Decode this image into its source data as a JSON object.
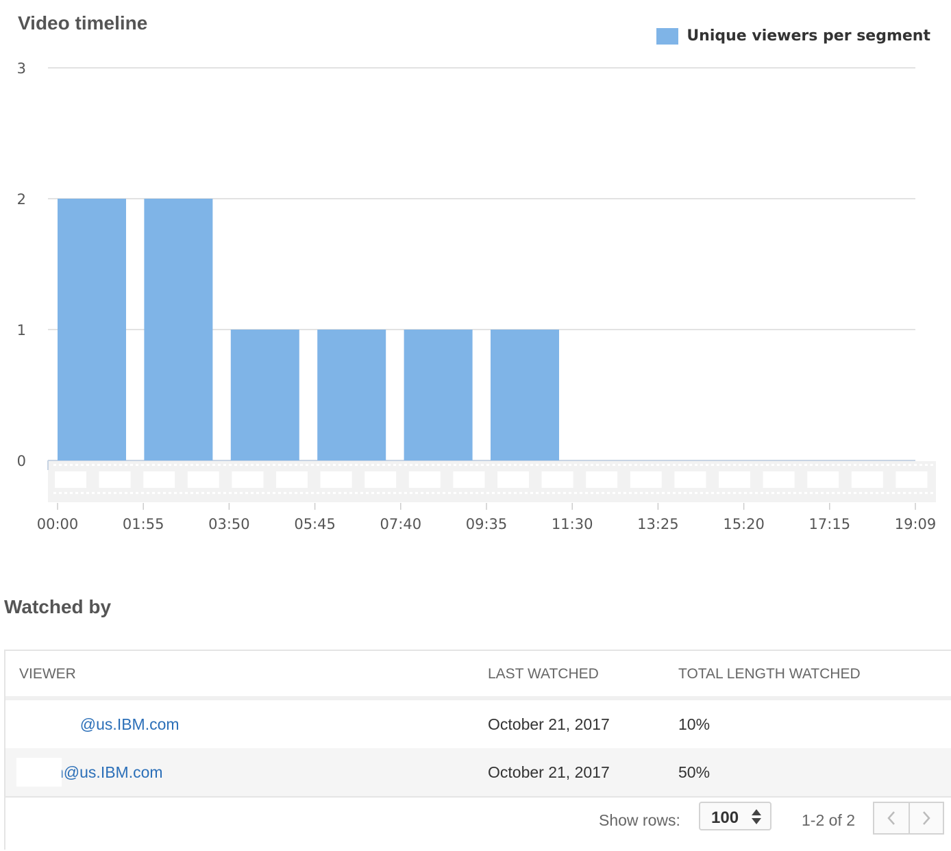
{
  "chart_data": {
    "type": "bar",
    "title": "Video timeline",
    "x_tick_labels": [
      "00:00",
      "01:55",
      "03:50",
      "05:45",
      "07:40",
      "09:35",
      "11:30",
      "13:25",
      "15:20",
      "17:15",
      "19:09"
    ],
    "series": [
      {
        "name": "Unique viewers per segment",
        "values": [
          2,
          2,
          1,
          1,
          1,
          1
        ]
      }
    ],
    "yticks": [
      0,
      1,
      2,
      3
    ],
    "ylim": [
      0,
      3
    ],
    "grid": true,
    "legend_position": "top-right",
    "bar_color": "#7fb4e7"
  },
  "watched": {
    "title": "Watched by",
    "columns": [
      "VIEWER",
      "LAST WATCHED",
      "TOTAL LENGTH WATCHED"
    ],
    "rows": [
      {
        "viewer": "n@us.IBM.com",
        "last_watched": "October 21, 2017",
        "total": "10%"
      },
      {
        "viewer": "n@us.IBM.com",
        "last_watched": "October 21, 2017",
        "total": "50%"
      }
    ],
    "show_rows_label": "Show rows:",
    "rows_per_page": "100",
    "range": "1-2 of 2"
  }
}
